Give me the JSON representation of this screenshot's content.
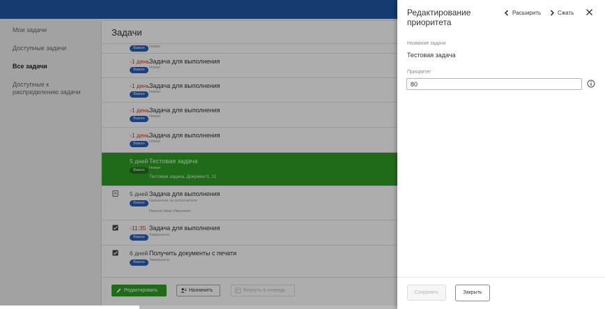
{
  "sidebar": {
    "items": [
      {
        "label": "Мои задачи"
      },
      {
        "label": "Доступные задачи"
      },
      {
        "label": "Все задачи"
      },
      {
        "label": "Доступные к распределению задачи"
      }
    ]
  },
  "main": {
    "title": "Задачи",
    "rows": [
      {
        "deadline": "",
        "badge": "Важно",
        "title": "",
        "status": "Новая",
        "extra": ""
      },
      {
        "deadline": "-1 день",
        "badge": "Важно",
        "title": "Задача для выполнения",
        "status": "Новая",
        "extra": ""
      },
      {
        "deadline": "-1 день",
        "badge": "Важно",
        "title": "Задача для выполнения",
        "status": "Новая",
        "extra": ""
      },
      {
        "deadline": "-1 день",
        "badge": "Важно",
        "title": "Задача для выполнения",
        "status": "Новая",
        "extra": ""
      },
      {
        "deadline": "-1 день",
        "badge": "Важно",
        "title": "Задача для выполнения",
        "status": "Новая",
        "extra": ""
      },
      {
        "deadline": "5 дней",
        "badge": "Важно",
        "title": "Тестовая задача",
        "status": "Новая",
        "extra": "Тестовая задача, Документ1, 11"
      },
      {
        "deadline": "5 дней",
        "badge": "Важно",
        "title": "Задача для выполнения",
        "status": "Назначена на исполнителя",
        "extra": "Иванов Иван Иванович"
      },
      {
        "deadline": "-11:35",
        "badge": "Важно",
        "title": "Задача для выполнения",
        "status": "Завершена",
        "extra": ""
      },
      {
        "deadline": "6 дней",
        "badge": "Важно",
        "title": "Получить документы с печати",
        "status": "Завершена",
        "extra": ""
      }
    ]
  },
  "footer": {
    "edit_label": "Редактировать",
    "assign_label": "Назначить",
    "return_label": "Вернуть в очередь"
  },
  "panel": {
    "title": "Редактирование приоритета",
    "expand_label": "Расширить",
    "collapse_label": "Сжать",
    "task_name_label": "Название задачи",
    "task_name_value": "Тестовая задача",
    "priority_label": "Приоритет",
    "priority_value": "80",
    "save_label": "Сохранить",
    "close_label": "Закрыть"
  },
  "colors": {
    "topbar": "#1f57a6",
    "selected_row": "#2f9e25",
    "badge": "#2a5db8",
    "overdue": "#d0372c"
  },
  "icons": {
    "row_doc": "document-icon",
    "row_check": "checkbox-checked-icon",
    "edit": "pencil-icon",
    "assign": "assign-user-icon",
    "return": "return-queue-icon",
    "info": "info-icon",
    "close": "close-icon",
    "expand": "chevron-left-icon",
    "collapse": "chevron-right-icon"
  }
}
